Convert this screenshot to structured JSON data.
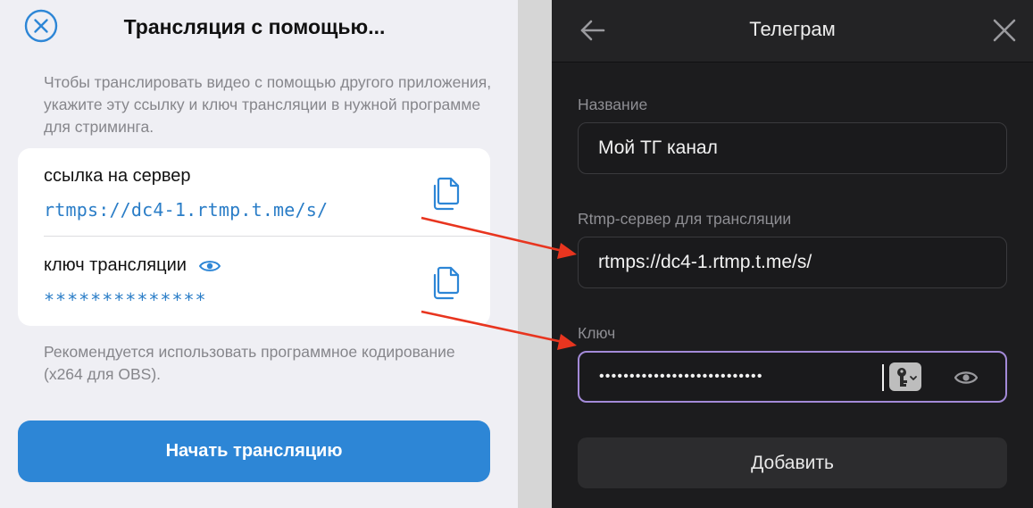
{
  "left_panel": {
    "title": "Трансляция с помощью...",
    "description": "Чтобы транслировать видео с помощью другого приложения, укажите эту ссылку и ключ трансляции в нужной программе для стриминга.",
    "server_label": "ссылка на сервер",
    "server_value": "rtmps://dc4-1.rtmp.t.me/s/",
    "key_label": "ключ трансляции",
    "key_value": "**************",
    "hint": "Рекомендуется использовать программное кодирование (x264 для OBS).",
    "start_button": "Начать трансляцию",
    "accent_color": "#2d86d6"
  },
  "right_panel": {
    "title": "Телеграм",
    "name_label": "Название",
    "name_value": "Мой ТГ канал",
    "server_label": "Rtmp-сервер для трансляции",
    "server_value": "rtmps://dc4-1.rtmp.t.me/s/",
    "key_label": "Ключ",
    "key_value": "•••••••••••••••••••••••••••",
    "add_button": "Добавить",
    "focus_color": "#a38ad8"
  },
  "icons": {
    "close": "close-circle-icon",
    "copy": "copy-icon",
    "eye": "eye-icon",
    "back": "back-arrow-icon",
    "keychain": "keychain-icon"
  },
  "annotations": {
    "arrow_color": "#e8351f"
  }
}
